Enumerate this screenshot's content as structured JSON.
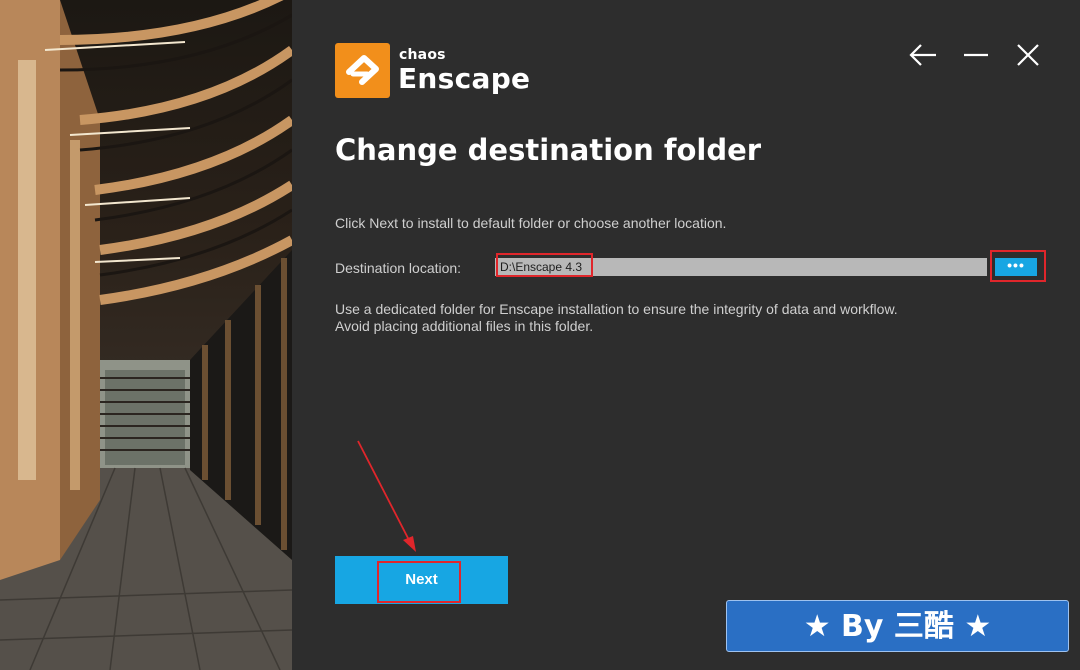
{
  "brand": {
    "small": "chaos",
    "name": "Enscape",
    "logo_color": "#f28f1b"
  },
  "window_controls": {
    "back_icon": "arrow-left-icon",
    "minimize_icon": "minimize-icon",
    "close_icon": "close-icon"
  },
  "page": {
    "title": "Change destination folder",
    "instruction": "Click Next to install to default folder or choose another location."
  },
  "destination": {
    "label": "Destination location:",
    "value": "D:\\Enscape 4.3",
    "browse_label": "•••"
  },
  "note": {
    "line1": "Use a dedicated folder for Enscape installation to ensure the integrity of data and workflow.",
    "line2": "Avoid placing additional files in this folder."
  },
  "actions": {
    "next_label": "Next",
    "accent_color": "#17a6e3"
  },
  "annotations": {
    "highlight_color": "#e0262b"
  },
  "watermark": {
    "text": "★ By 三酷 ★"
  }
}
